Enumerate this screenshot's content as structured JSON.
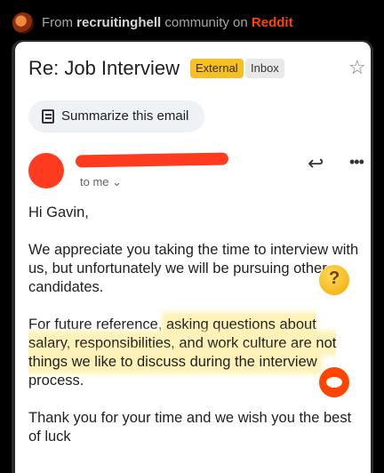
{
  "source": {
    "prefix": "From",
    "community": "recruitinghell",
    "middle": "community on",
    "site": "Reddit"
  },
  "email": {
    "subject": "Re: Job Interview",
    "labels": [
      "External",
      "Inbox"
    ],
    "summarize_label": "Summarize this email",
    "recipient_label": "to me ⌄",
    "greeting": "Hi Gavin,",
    "para1": "We appreciate you taking the time to interview with us, but unfortunately we will be pursuing other candidates.",
    "para2_before": "For future reference, ",
    "para2_highlight": "asking questions about salary, responsibilities, and work culture are not things we like to discuss during the interview",
    "para2_after": " process.",
    "para3": "Thank you for your time and we wish you the best of luck"
  },
  "icons": {
    "star": "star-icon",
    "reply": "reply-icon",
    "more": "more-icon",
    "summarize": "summarize-icon",
    "thinking": "thinking-face-emoji",
    "reddit": "reddit-logo"
  },
  "colors": {
    "reddit_orange": "#ff4500",
    "highlight": "#fff2b8",
    "external_badge": "#f5c024"
  }
}
